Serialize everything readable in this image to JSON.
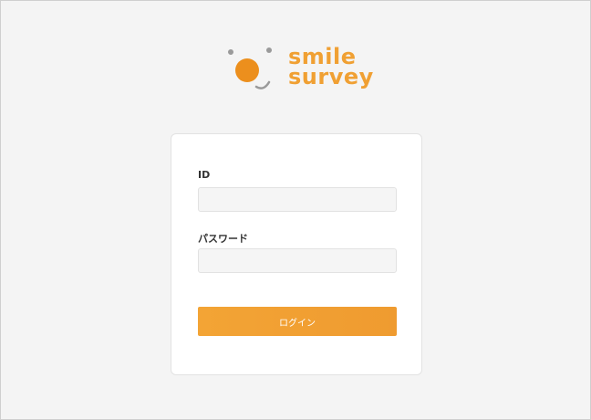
{
  "logo": {
    "line1": "smile",
    "line2": "survey",
    "brand_color": "#f0a033",
    "mascot_color": "#ec8f1d",
    "accent_gray": "#9a9a9a"
  },
  "form": {
    "id_label": "ID",
    "id_value": "",
    "password_label": "パスワード",
    "password_value": "",
    "login_label": "ログイン"
  },
  "colors": {
    "background": "#f4f4f4",
    "card": "#ffffff",
    "button": "#f0a033"
  }
}
